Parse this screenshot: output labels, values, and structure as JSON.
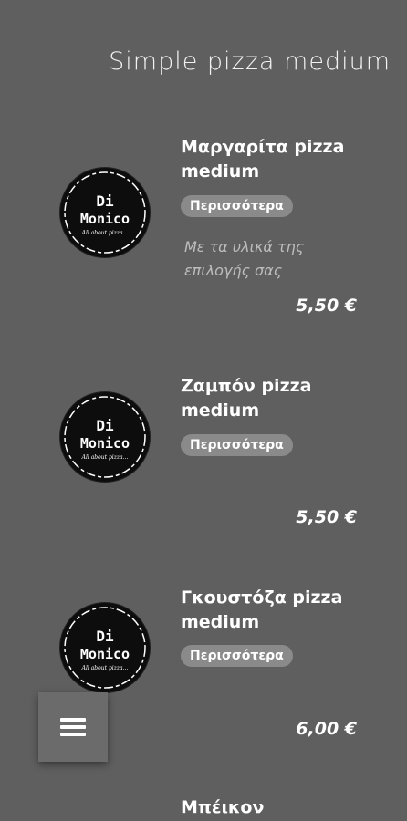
{
  "page": {
    "title": "Simple pizza medium"
  },
  "logo": {
    "line1": "Di",
    "line2": "Monico",
    "tagline": "All about pizza..."
  },
  "items": [
    {
      "name": "Μαργαρίτα pizza medium",
      "more_label": "Περισσότερα",
      "description": "Με τα υλικά της επιλογής σας",
      "price": "5,50 €"
    },
    {
      "name": "Ζαμπόν pizza medium",
      "more_label": "Περισσότερα",
      "description": "",
      "price": "5,50 €"
    },
    {
      "name": "Γκουστόζα pizza medium",
      "more_label": "Περισσότερα",
      "description": "",
      "price": "6,00 €"
    }
  ],
  "partial_item": {
    "name": "Μπέικον"
  },
  "menu_button": {
    "icon": "hamburger-menu-icon"
  },
  "colors": {
    "background": "#5f5f5f",
    "button_bg": "#8a8a8a",
    "logo_bg": "#0d0d0d"
  }
}
